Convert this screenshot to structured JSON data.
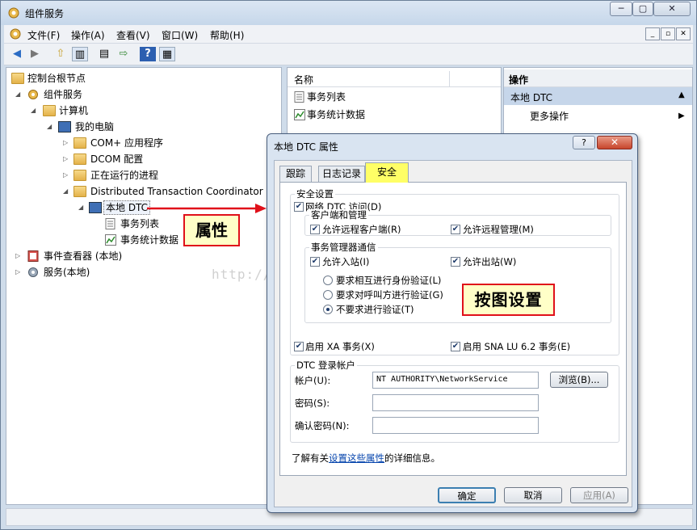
{
  "window": {
    "title": "组件服务",
    "min": "─",
    "max": "▢",
    "close": "✕"
  },
  "menu": {
    "items": [
      "文件(F)",
      "操作(A)",
      "查看(V)",
      "窗口(W)",
      "帮助(H)"
    ],
    "inner_min": "_",
    "inner_max": "▫",
    "inner_close": "✕"
  },
  "toolbar": {
    "back": "◀",
    "forward": "▶",
    "up": "⇧",
    "tree": "▥",
    "export": "▤",
    "arrow": "⇨",
    "help": "?",
    "details": "▦"
  },
  "tree": {
    "root": "控制台根节点",
    "services": "组件服务",
    "computers": "计算机",
    "my_computer": "我的电脑",
    "com_apps": "COM+ 应用程序",
    "dcom": "DCOM 配置",
    "running": "正在运行的进程",
    "dtc": "Distributed Transaction Coordinator",
    "local_dtc": "本地 DTC",
    "tx_list": "事务列表",
    "tx_stats": "事务统计数据",
    "event_viewer": "事件查看器 (本地)",
    "services_local": "服务(本地)"
  },
  "middle": {
    "header": "名称",
    "items": [
      "事务列表",
      "事务统计数据"
    ]
  },
  "actions": {
    "header": "操作",
    "selected": "本地 DTC",
    "more": "更多操作",
    "arrow": "▶",
    "up_arrow": "▲"
  },
  "watermark": "http://blog.csdn.net/jiben2qingshan",
  "callouts": {
    "properties": "属性",
    "set_as_shown": "按图设置"
  },
  "dialog": {
    "title": "本地 DTC 属性",
    "help": "?",
    "close": "✕",
    "tabs": [
      "跟踪",
      "日志记录",
      "安全"
    ],
    "security_group": "安全设置",
    "network_access": "网络 DTC 访问(D)",
    "client_admin_group": "客户端和管理",
    "allow_remote_clients": "允许远程客户端(R)",
    "allow_remote_admin": "允许远程管理(M)",
    "tm_comm_group": "事务管理器通信",
    "allow_inbound": "允许入站(I)",
    "allow_outbound": "允许出站(W)",
    "mutual_auth": "要求相互进行身份验证(L)",
    "caller_auth": "要求对呼叫方进行验证(G)",
    "no_auth": "不要求进行验证(T)",
    "enable_xa": "启用 XA 事务(X)",
    "enable_sna": "启用 SNA LU 6.2 事务(E)",
    "logon_group": "DTC 登录帐户",
    "account_label": "帐户(U):",
    "account_value": "NT AUTHORITY\\NetworkService",
    "browse": "浏览(B)...",
    "password_label": "密码(S):",
    "confirm_label": "确认密码(N):",
    "info_prefix": "了解有关",
    "info_link": "设置这些属性",
    "info_suffix": "的详细信息。",
    "ok": "确定",
    "cancel": "取消",
    "apply": "应用(A)",
    "checked": "✔"
  },
  "colors": {
    "callout_border": "#e0101a",
    "callout_fill": "#ffffc8",
    "active_tab": "#ffff66",
    "selected_action": "#c6d6ea"
  }
}
